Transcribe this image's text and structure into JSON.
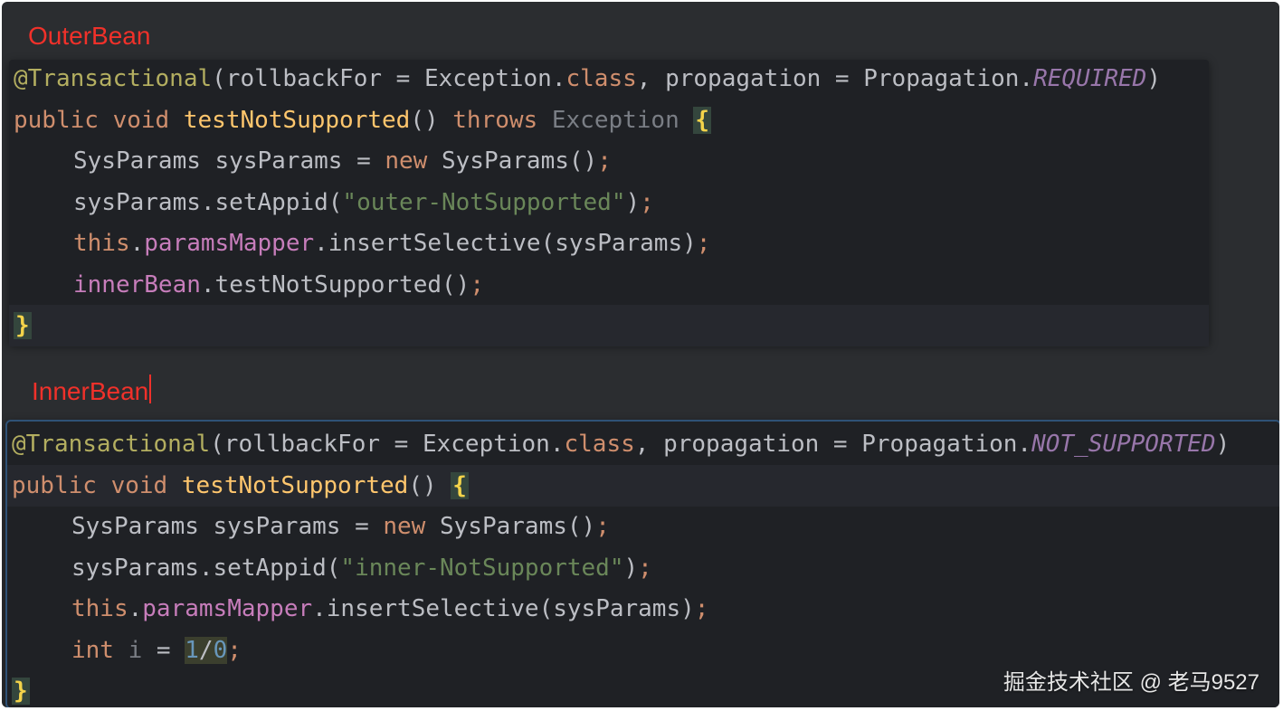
{
  "labels": {
    "outer": "OuterBean",
    "inner": "InnerBean"
  },
  "outer": {
    "annotation": "@Transactional",
    "annotation_open": "(rollbackFor = Exception.",
    "class_kw": "class",
    "annotation_mid": ", propagation = Propagation.",
    "propagation": "REQUIRED",
    "annotation_close": ")",
    "public": "public",
    "void": "void",
    "method": "testNotSupported",
    "parens": "()",
    "throws": "throws",
    "exception": "Exception",
    "open_brace": "{",
    "l3_type": "SysParams sysParams = ",
    "l3_new": "new",
    "l3_ctor": " SysParams()",
    "l3_semi": ";",
    "l4_call": "sysParams.setAppid(",
    "l4_str": "\"outer-NotSupported\"",
    "l4_close": ")",
    "l4_semi": ";",
    "l5_this": "this",
    "l5_dot": ".",
    "l5_field": "paramsMapper",
    "l5_call": ".insertSelective(sysParams)",
    "l5_semi": ";",
    "l6_field": "innerBean",
    "l6_call": ".testNotSupported()",
    "l6_semi": ";",
    "close_brace": "}"
  },
  "inner": {
    "annotation": "@Transactional",
    "annotation_open": "(rollbackFor = Exception.",
    "class_kw": "class",
    "annotation_mid": ", propagation = Propagation.",
    "propagation": "NOT_SUPPORTED",
    "annotation_close": ")",
    "public": "public",
    "void": "void",
    "method": "testNotSupported",
    "parens": "() ",
    "open_brace": "{",
    "l3_type": "SysParams sysParams = ",
    "l3_new": "new",
    "l3_ctor": " SysParams()",
    "l3_semi": ";",
    "l4_call": "sysParams.setAppid(",
    "l4_str": "\"inner-NotSupported\"",
    "l4_close": ")",
    "l4_semi": ";",
    "l5_this": "this",
    "l5_dot": ".",
    "l5_field": "paramsMapper",
    "l5_call": ".insertSelective(sysParams)",
    "l5_semi": ";",
    "l6_int": "int",
    "l6_var": "i",
    "l6_eq": " = ",
    "l6_num1": "1",
    "l6_div": "/",
    "l6_num2": "0",
    "l6_semi": ";",
    "close_brace": "}"
  },
  "watermark": "掘金技术社区 @ 老马9527"
}
